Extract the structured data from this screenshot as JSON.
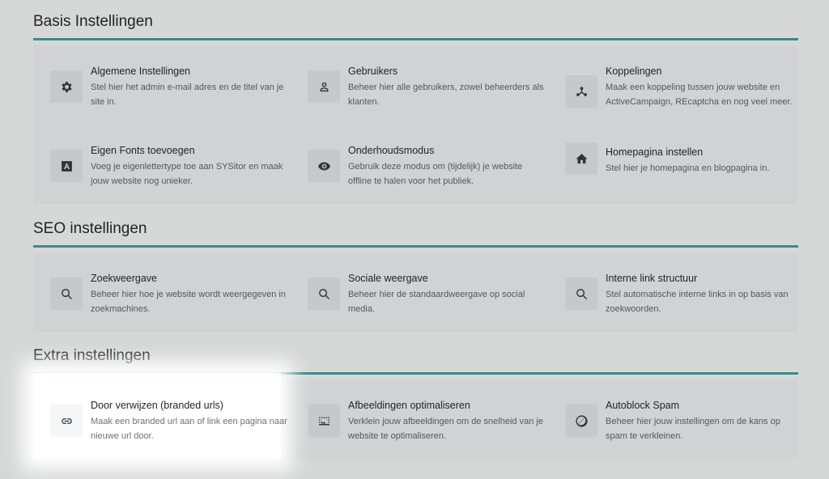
{
  "sections": [
    {
      "title": "Basis Instellingen",
      "items": [
        {
          "title": "Algemene Instellingen",
          "desc": "Stel hier het admin e-mail adres en de titel van je site in.",
          "icon": "gear-icon"
        },
        {
          "title": "Gebruikers",
          "desc": "Beheer hier alle gebruikers, zowel beheerders als klanten.",
          "icon": "user-icon"
        },
        {
          "title": "Koppelingen",
          "desc": "Maak een koppeling tussen jouw website en ActiveCampaign, REcaptcha en nog veel meer.",
          "icon": "network-icon"
        },
        {
          "title": "Eigen Fonts toevoegen",
          "desc": "Voeg je eigenlettertype toe aan SYSitor en maak jouw website nog unieker.",
          "icon": "font-icon"
        },
        {
          "title": "Onderhoudsmodus",
          "desc": "Gebruik deze modus om (tijdelijk) je website offline te halen voor het publiek.",
          "icon": "eye-icon"
        },
        {
          "title": "Homepagina instellen",
          "desc": "Stel hier je homepagina en blogpagina in.",
          "icon": "home-icon"
        }
      ]
    },
    {
      "title": "SEO instellingen",
      "items": [
        {
          "title": "Zoekweergave",
          "desc": "Beheer hier hoe je website wordt weergegeven in zoekmachines.",
          "icon": "search-icon"
        },
        {
          "title": "Sociale weergave",
          "desc": "Beheer hier de standaardweergave op social media.",
          "icon": "search-icon"
        },
        {
          "title": "Interne link structuur",
          "desc": "Stel automatische interne links in op basis van zoekwoorden.",
          "icon": "search-icon"
        }
      ]
    },
    {
      "title": "Extra instellingen",
      "items": [
        {
          "title": "Door verwijzen (branded urls)",
          "desc": "Maak een branded url aan of link een pagina naar nieuwe url door.",
          "icon": "link-icon"
        },
        {
          "title": "Afbeeldingen optimaliseren",
          "desc": "Verklein jouw afbeeldingen om de snelheid van je website te optimaliseren.",
          "icon": "image-icon"
        },
        {
          "title": "Autoblock Spam",
          "desc": "Beheer hier jouw instellingen om de kans op spam te verkleinen.",
          "icon": "block-icon"
        }
      ]
    }
  ]
}
